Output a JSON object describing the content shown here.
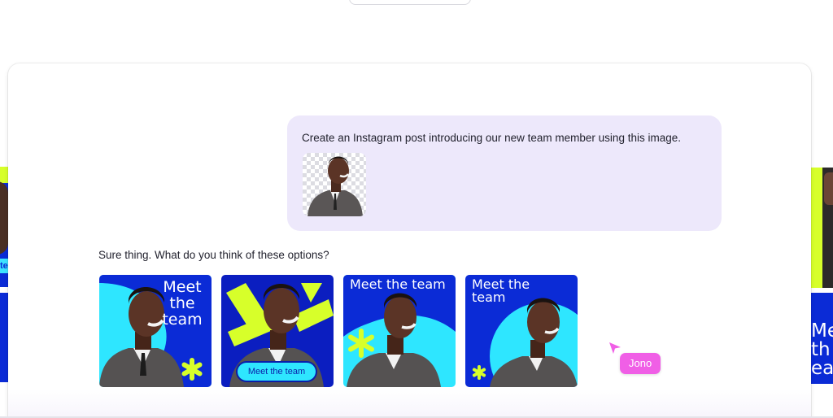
{
  "conversation": {
    "user_message": "Create an Instagram post introducing our new team member using this image.",
    "attachment_icon": "person-photo-thumbnail",
    "assistant_message": "Sure thing. What do you think of these options?"
  },
  "options": [
    {
      "title": "Meet\nthe\nteam",
      "style": "blue-circle-asterisk"
    },
    {
      "title": "Meet the team",
      "style": "lime-shapes-pill"
    },
    {
      "title": "Meet the team",
      "style": "cyan-banner"
    },
    {
      "title": "Meet the\nteam",
      "style": "cyan-ring"
    }
  ],
  "collaborator": {
    "name": "Jono",
    "color": "#f05fe6"
  },
  "background_peeks": {
    "left_tag": "te",
    "right_text": [
      "Mee",
      "th",
      "ea"
    ]
  },
  "colors": {
    "brand_blue": "#0b2bd6",
    "cyan": "#2ee6ff",
    "lime": "#d7ff2a",
    "bubble": "#ede8fb"
  }
}
